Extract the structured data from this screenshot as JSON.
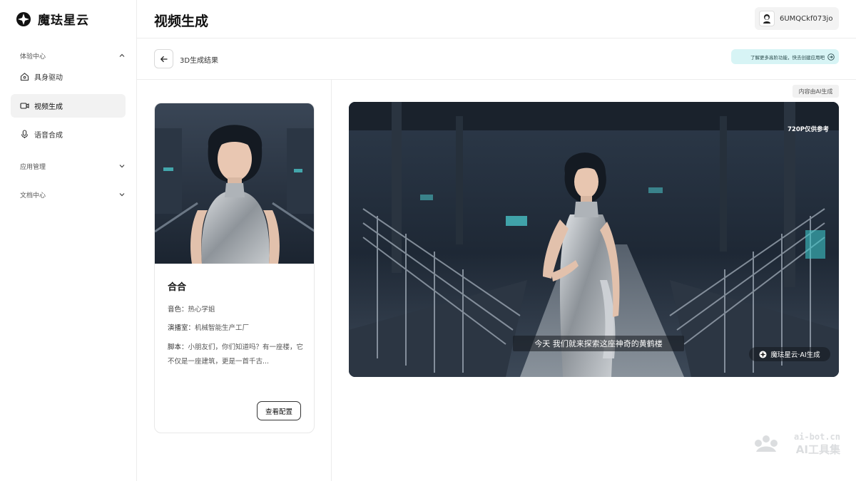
{
  "app": {
    "name": "魔珐星云",
    "page_title": "视频生成"
  },
  "user": {
    "name": "6UMQCkf073jo"
  },
  "sidebar": {
    "group_experience": "体验中心",
    "items": [
      {
        "label": "具身驱动",
        "icon": "home-icon",
        "active": false
      },
      {
        "label": "视频生成",
        "icon": "video-icon",
        "active": true
      },
      {
        "label": "语音合成",
        "icon": "microphone-icon",
        "active": false
      }
    ],
    "group_apps": "应用管理",
    "group_docs": "文档中心"
  },
  "subheader": {
    "title": "3D生成结果",
    "promo": "了解更多高阶功能，快去创建应用吧"
  },
  "card": {
    "name": "合合",
    "voice_label": "音色：",
    "voice_value": "热心学姐",
    "studio_label": "演播室：",
    "studio_value": "机械智能生产工厂",
    "script_label": "脚本：",
    "script_value": "小朋友们，你们知道吗？有一座楼，它不仅是一座建筑，更是一首千古...",
    "config_button": "查看配置"
  },
  "video": {
    "ai_badge": "内容由AI生成",
    "resolution_note": "720P仅供参考",
    "subtitle": "今天 我们就来探索这座神奇的黄鹤楼",
    "watermark": "魔珐星云·AI生成"
  },
  "corner_watermark": {
    "line1": "ai-bot.cn",
    "line2": "AI工具集"
  },
  "colors": {
    "promo_bg": "#d7f4f5",
    "active_nav_bg": "#f2f2f2",
    "border": "#ececec"
  }
}
